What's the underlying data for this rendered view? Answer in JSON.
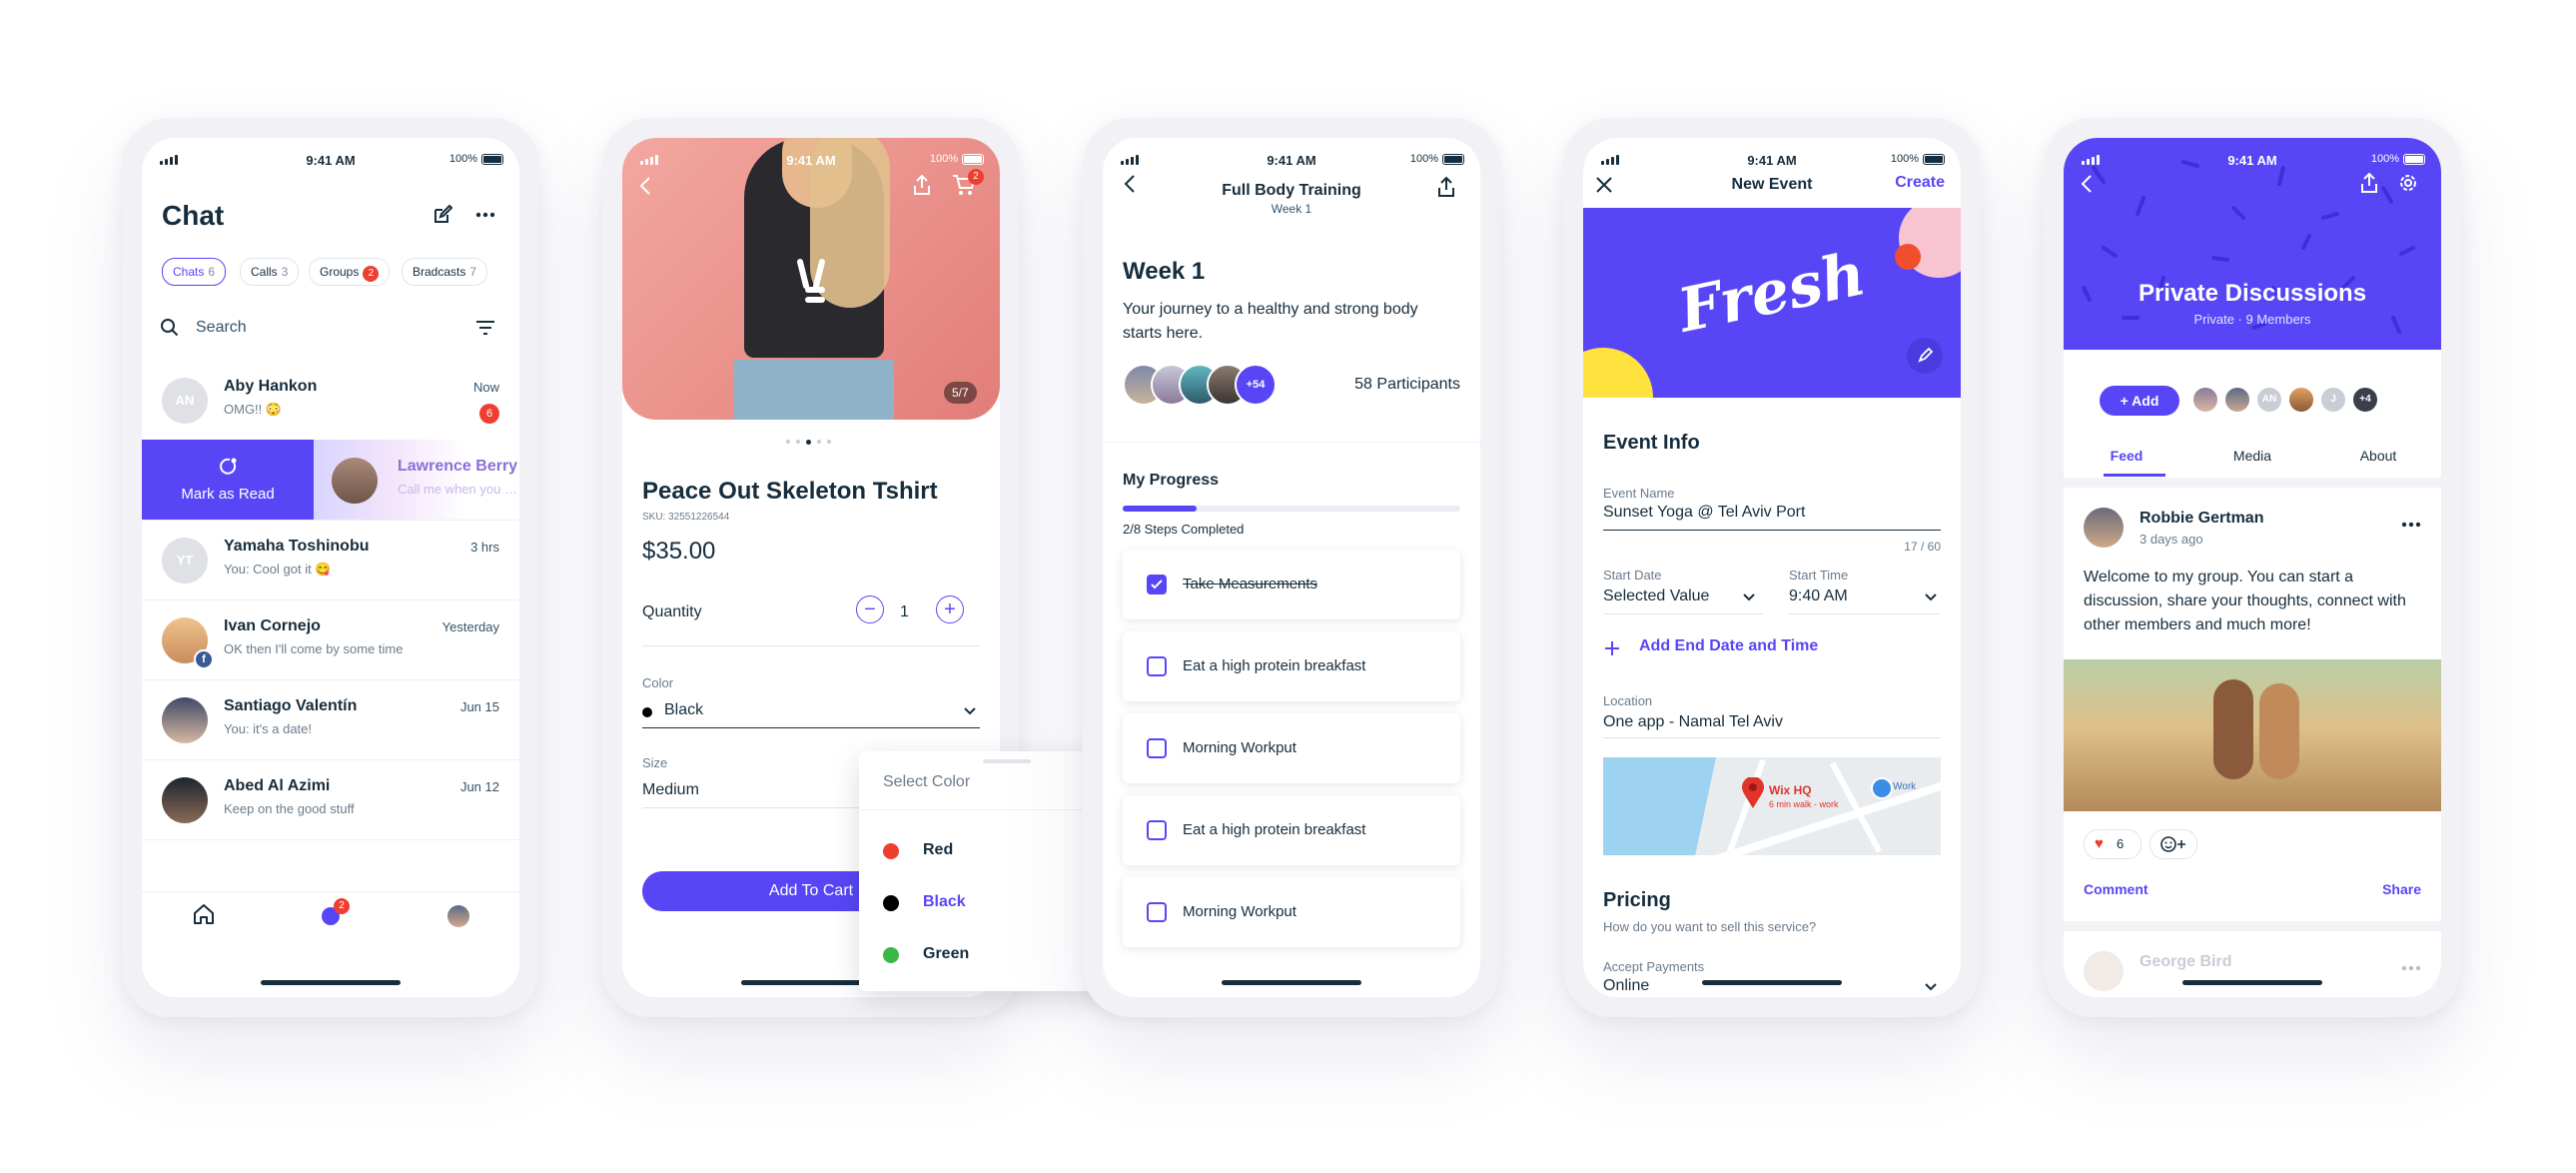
{
  "status_bar": {
    "time": "9:41 AM",
    "battery": "100%"
  },
  "chat": {
    "title": "Chat",
    "tabs": [
      {
        "label": "Chats",
        "count": "6"
      },
      {
        "label": "Calls",
        "count": "3"
      },
      {
        "label": "Groups",
        "count": "2"
      },
      {
        "label": "Bradcasts",
        "count": "7"
      }
    ],
    "search_placeholder": "Search",
    "swipe_action": "Mark as Read",
    "conversations": [
      {
        "initials": "AN",
        "name": "Aby Hankon",
        "message": "OMG!! 😳",
        "time": "Now",
        "unread": "6"
      },
      {
        "initials": "",
        "name": "Lawrence Berry",
        "message": "Call me when you can",
        "time": "",
        "unread": ""
      },
      {
        "initials": "YT",
        "name": "Yamaha Toshinobu",
        "message": "You: Cool got it 😋",
        "time": "3 hrs",
        "unread": ""
      },
      {
        "initials": "",
        "name": "Ivan Cornejo",
        "message": "OK then I'll come by some time",
        "time": "Yesterday",
        "unread": ""
      },
      {
        "initials": "",
        "name": "Santiago Valentín",
        "message": "You: it's a date!",
        "time": "Jun 15",
        "unread": ""
      },
      {
        "initials": "",
        "name": "Abed Al Azimi",
        "message": "Keep on the good stuff",
        "time": "Jun 12",
        "unread": ""
      }
    ],
    "nav_badge": "2"
  },
  "shop": {
    "cart_badge": "2",
    "image_counter": "5/7",
    "product_name": "Peace Out Skeleton Tshirt",
    "sku": "SKU: 32551226544",
    "price": "$35.00",
    "quantity_label": "Quantity",
    "quantity_value": "1",
    "color_label": "Color",
    "color_value": "Black",
    "size_label": "Size",
    "size_value": "Medium",
    "add_to_cart": "Add To Cart",
    "color_sheet": {
      "title": "Select Color",
      "options": [
        {
          "label": "Red",
          "color": "#ee3e30"
        },
        {
          "label": "Black",
          "color": "#000000"
        },
        {
          "label": "Green",
          "color": "#3cb84a"
        }
      ],
      "selected": "Black"
    }
  },
  "training": {
    "title": "Full Body Training",
    "subtitle": "Week 1",
    "heading": "Week 1",
    "description": "Your journey to a healthy and strong body starts here.",
    "extra_participants": "+54",
    "participants": "58 Participants",
    "progress_label": "My Progress",
    "progress_text": "2/8 Steps Completed",
    "progress_fraction": 0.22,
    "tasks": [
      {
        "label": "Take Measurements",
        "done": true
      },
      {
        "label": "Eat a high protein breakfast",
        "done": false
      },
      {
        "label": "Morning Workput",
        "done": false
      },
      {
        "label": "Eat a high protein breakfast",
        "done": false
      },
      {
        "label": "Morning Workput",
        "done": false
      }
    ]
  },
  "event": {
    "title": "New Event",
    "create": "Create",
    "banner_text": "Fresh",
    "section_info": "Event Info",
    "name_label": "Event Name",
    "name_value": "Sunset Yoga @ Tel Aviv Port",
    "char_count": "17 / 60",
    "start_date_label": "Start Date",
    "start_date_value": "Selected Value",
    "start_time_label": "Start Time",
    "start_time_value": "9:40 AM",
    "add_end": "Add End Date and Time",
    "location_label": "Location",
    "location_value": "One app - Namal Tel Aviv",
    "map_pin_title": "Wix HQ",
    "map_pin_sub": "6 min walk - work",
    "map_work": "Work",
    "pricing_title": "Pricing",
    "pricing_sub": "How do you want to sell this service?",
    "payments_label": "Accept Payments",
    "payments_value": "Online"
  },
  "group": {
    "title": "Private Discussions",
    "subtitle": "Private · 9 Members",
    "add_button": "Add",
    "member_initials": [
      "AN",
      "J"
    ],
    "extra_members": "+4",
    "tabs": [
      "Feed",
      "Media",
      "About"
    ],
    "post": {
      "author": "Robbie Gertman",
      "time": "3 days ago",
      "text": "Welcome to my group. You can start a discussion, share your thoughts, connect with other members and much more!",
      "likes": "6",
      "comment": "Comment",
      "share": "Share"
    },
    "next_author": "George Bird"
  },
  "colors": {
    "accent": "#5846f6",
    "badge": "#ee3e30",
    "text": "#162d3d"
  }
}
